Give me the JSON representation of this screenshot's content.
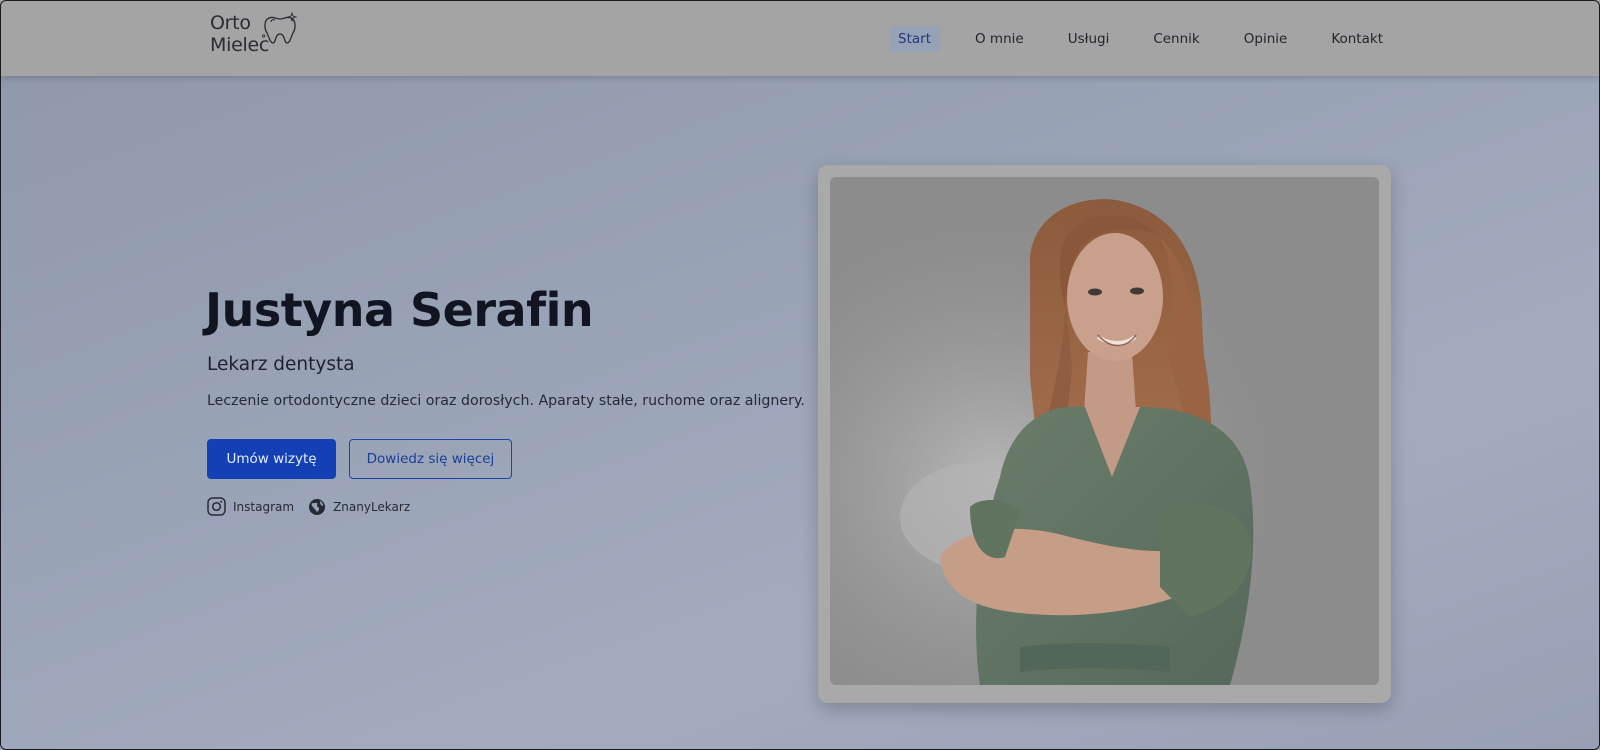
{
  "header": {
    "logo": {
      "line1": "Orto",
      "line2": "Mielec",
      "icon": "tooth-icon"
    },
    "nav": [
      {
        "label": "Start",
        "active": true
      },
      {
        "label": "O mnie",
        "active": false
      },
      {
        "label": "Usługi",
        "active": false
      },
      {
        "label": "Cennik",
        "active": false
      },
      {
        "label": "Opinie",
        "active": false
      },
      {
        "label": "Kontakt",
        "active": false
      }
    ]
  },
  "hero": {
    "title": "Justyna Serafin",
    "subtitle": "Lekarz dentysta",
    "description": "Leczenie ortodontyczne dzieci oraz dorosłych. Aparaty stałe, ruchome oraz alignery.",
    "primary_button": "Umów wizytę",
    "secondary_button": "Dowiedz się więcej",
    "social": [
      {
        "label": "Instagram",
        "icon": "instagram-icon"
      },
      {
        "label": "ZnanyLekarz",
        "icon": "globe-icon"
      }
    ]
  },
  "photo": {
    "subject": "portrait-photo"
  },
  "colors": {
    "primary": "#1340b4",
    "header_bg": "#a4a4a4",
    "title": "#121521"
  }
}
